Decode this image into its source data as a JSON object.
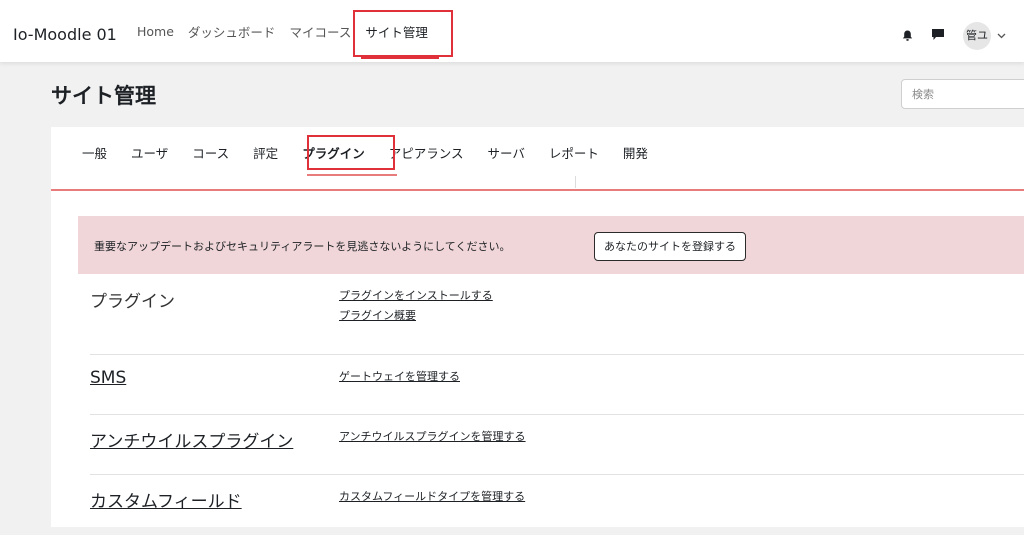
{
  "navbar": {
    "brand": "Io-Moodle 01",
    "items": [
      {
        "label": "Home"
      },
      {
        "label": "ダッシュボード"
      },
      {
        "label": "マイコース"
      },
      {
        "label": "サイト管理"
      }
    ],
    "user_initials": "管ユ"
  },
  "page": {
    "title": "サイト管理",
    "search_placeholder": "検索"
  },
  "tabs": [
    {
      "label": "一般"
    },
    {
      "label": "ユーザ"
    },
    {
      "label": "コース"
    },
    {
      "label": "評定"
    },
    {
      "label": "プラグイン"
    },
    {
      "label": "アピアランス"
    },
    {
      "label": "サーバ"
    },
    {
      "label": "レポート"
    },
    {
      "label": "開発"
    }
  ],
  "alert": {
    "text": "重要なアップデートおよびセキュリティアラートを見逃さないようにしてください。",
    "button_label": "あなたのサイトを登録する"
  },
  "sections": [
    {
      "title": "プラグイン",
      "links": [
        "プラグインをインストールする",
        "プラグイン概要"
      ]
    },
    {
      "title": "SMS",
      "links": [
        "ゲートウェイを管理する"
      ]
    },
    {
      "title": "アンチウイルスプラグイン",
      "links": [
        "アンチウイルスプラグインを管理する"
      ]
    },
    {
      "title": "カスタムフィールド",
      "links": [
        "カスタムフィールドタイプを管理する"
      ]
    }
  ],
  "colors": {
    "highlight": "#e0313b",
    "alert_bg": "#f0d6d8",
    "page_bg": "#f1f1f1"
  }
}
